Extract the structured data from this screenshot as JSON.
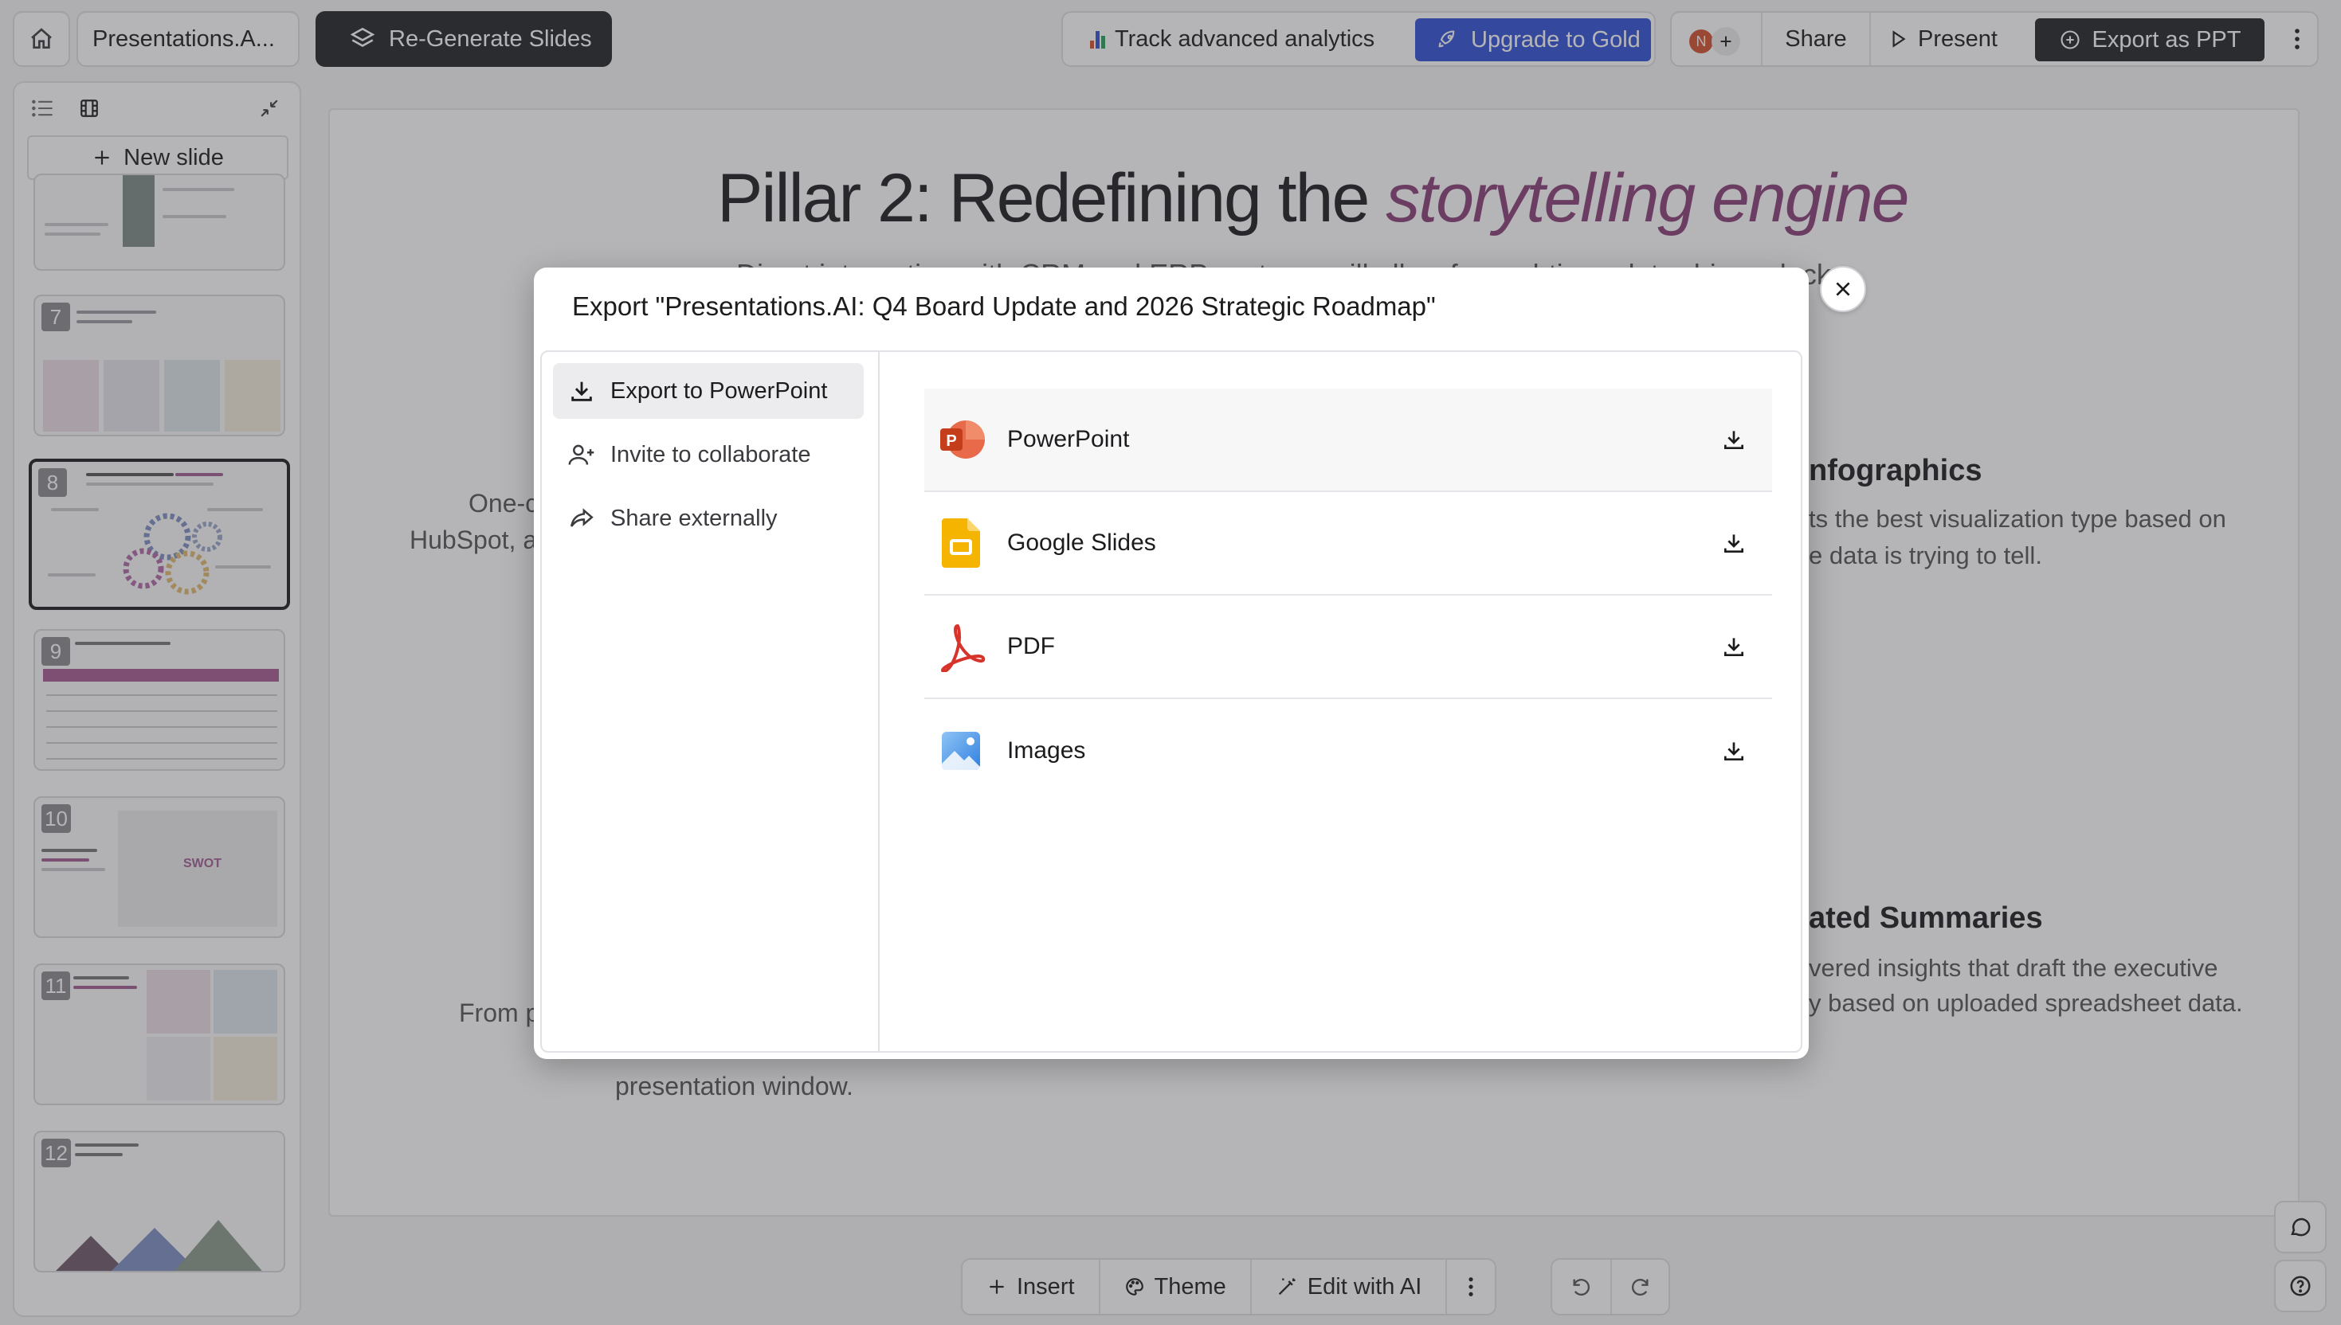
{
  "topbar": {
    "home_icon": "home-icon",
    "doc_title": "Presentations.A...",
    "regenerate_label": "Re-Generate Slides",
    "track_label": "Track advanced analytics",
    "upgrade_label": "Upgrade to Gold",
    "avatar_initial": "N",
    "share_label": "Share",
    "present_label": "Present",
    "export_label": "Export as PPT"
  },
  "sidebar": {
    "new_slide_label": "New slide",
    "slides": [
      {
        "number": "7",
        "title": "Empowering the enterprise governance"
      },
      {
        "number": "8",
        "title": "Pillar 2: Redefining the storytelling engine"
      },
      {
        "number": "9",
        "title": "Financial roadmap targets $50M ARR"
      },
      {
        "number": "10",
        "title": "Mitigating risks in a rapidly evolving AI landscape"
      },
      {
        "number": "11",
        "title": "Next steps: hyper-growth"
      },
      {
        "number": "12",
        "title": "the next era of communication"
      }
    ]
  },
  "slide": {
    "title_plain": "Pillar 2: Redefining the ",
    "title_accent": "storytelling engine",
    "subtitle_fragment_left": "Direct integration with CRM and ERP systems will allow for real-time, data-driven decks.",
    "left_fragment_1": "One-c",
    "left_fragment_2": "HubSpot, a",
    "left_fragment_3": "From p",
    "left_fragment_4": "presentation window.",
    "right_heading_1": "nfographics",
    "right_text_1a": "ts the best visualization type based on",
    "right_text_1b": "e data is trying to tell.",
    "right_heading_2": "ated Summaries",
    "right_text_2a": "vered insights that draft the executive",
    "right_text_2b": "y based on uploaded spreadsheet data."
  },
  "dialog": {
    "title": "Export \"Presentations.AI: Q4 Board Update and 2026 Strategic Roadmap\"",
    "nav": [
      {
        "label": "Export to PowerPoint",
        "icon": "download-icon",
        "selected": true
      },
      {
        "label": "Invite to collaborate",
        "icon": "user-plus-icon",
        "selected": false
      },
      {
        "label": "Share externally",
        "icon": "share-arrow-icon",
        "selected": false
      }
    ],
    "options": [
      {
        "label": "PowerPoint",
        "icon": "powerpoint-icon"
      },
      {
        "label": "Google Slides",
        "icon": "google-slides-icon"
      },
      {
        "label": "PDF",
        "icon": "pdf-icon"
      },
      {
        "label": "Images",
        "icon": "images-icon"
      }
    ]
  },
  "bottombar": {
    "insert_label": "Insert",
    "theme_label": "Theme",
    "edit_ai_label": "Edit with AI"
  },
  "colors": {
    "accent_gold": "#2f4fd6",
    "slide_accent": "#8a3e78",
    "powerpoint": "#d2502c",
    "google_slides": "#f4b400",
    "pdf": "#d8332b"
  }
}
